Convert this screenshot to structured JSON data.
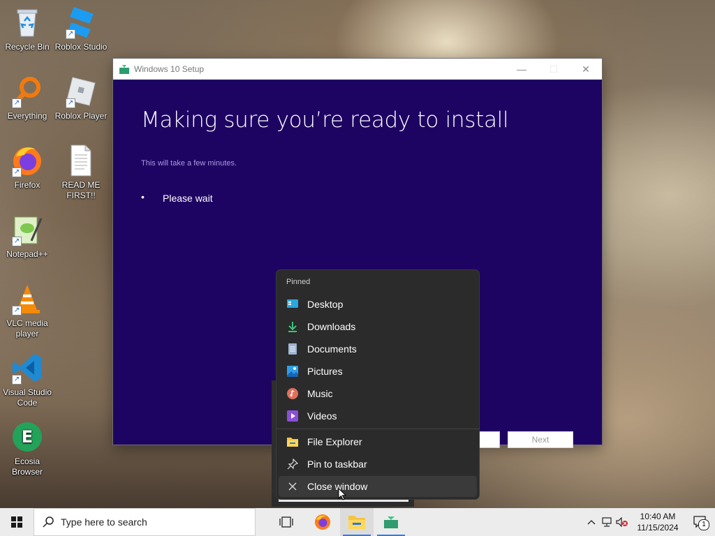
{
  "desktop": {
    "icons": [
      {
        "label": "Recycle Bin"
      },
      {
        "label": "Roblox Studio"
      },
      {
        "label": "Everything"
      },
      {
        "label": "Roblox Player"
      },
      {
        "label": "Firefox"
      },
      {
        "label": "READ ME FIRST!!"
      },
      {
        "label": "Notepad++"
      },
      {
        "label": "VLC media player"
      },
      {
        "label": "Visual Studio Code"
      },
      {
        "label": "Ecosia Browser"
      }
    ]
  },
  "setup_window": {
    "title": "Windows 10 Setup",
    "heading": "Making sure you’re ready to install",
    "subheading": "This will take a few minutes.",
    "progress_dot": "•",
    "status": "Please wait",
    "next_label": "Next"
  },
  "jump_list": {
    "section_label": "Pinned",
    "pinned": [
      {
        "label": "Desktop",
        "icon": "desktop-icon"
      },
      {
        "label": "Downloads",
        "icon": "downloads-icon"
      },
      {
        "label": "Documents",
        "icon": "documents-icon"
      },
      {
        "label": "Pictures",
        "icon": "pictures-icon"
      },
      {
        "label": "Music",
        "icon": "music-icon"
      },
      {
        "label": "Videos",
        "icon": "videos-icon"
      }
    ],
    "actions": [
      {
        "label": "File Explorer",
        "icon": "folder-icon"
      },
      {
        "label": "Pin to taskbar",
        "icon": "pin-icon"
      },
      {
        "label": "Close window",
        "icon": "close-icon"
      }
    ]
  },
  "taskbar": {
    "search_placeholder": "Type here to search",
    "clock_time": "10:40 AM",
    "clock_date": "11/15/2024",
    "notification_count": "1"
  },
  "colors": {
    "setup_background": "#1e0462",
    "jump_list_background": "#2b2b2b",
    "taskbar_background": "#ececec"
  }
}
